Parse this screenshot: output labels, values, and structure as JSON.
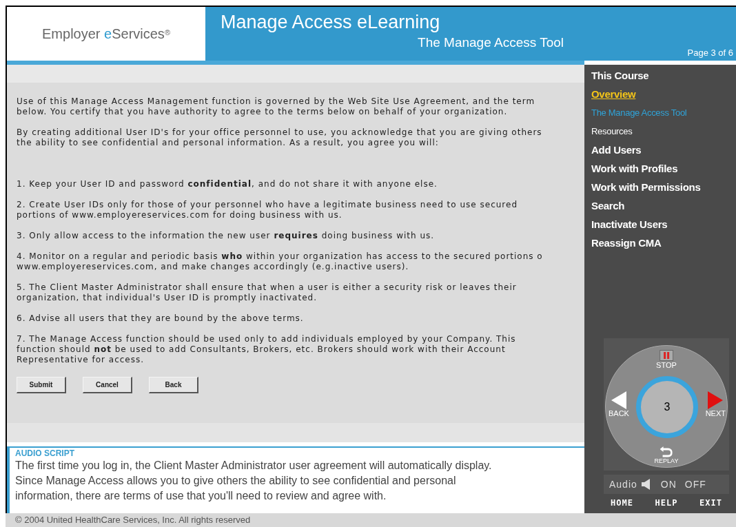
{
  "header": {
    "logo": {
      "prefix": "Employer ",
      "accent": "e",
      "suffix": "Services",
      "mark": "®"
    },
    "title": "Manage Access eLearning",
    "subtitle": "The Manage Access Tool",
    "page": "Page 3 of 6"
  },
  "agreement": {
    "paragraphs": [
      [
        "Use of this Manage Access Management function is governed by the Web Site Use Agreement, and the term",
        "below. You certify that you have authority to agree to the terms below on behalf of your organization."
      ],
      [
        "By creating additional User ID's for your office personnel to use, you acknowledge that you are giving others",
        "the ability to see confidential and personal information. As a result, you agree you will:"
      ]
    ],
    "terms": [
      [
        "1. Keep your User ID and password **confidential**, and do not share it with anyone else."
      ],
      [
        "2. Create User IDs only for those of your personnel who have a legitimate business need to use secured",
        "portions of www.employereservices.com for doing business with us."
      ],
      [
        "3. Only allow access to the information the new user **requires** doing business with us."
      ],
      [
        "4. Monitor on a regular and periodic basis **who** within your organization has access to the secured portions o",
        "www.employereservices.com, and make changes accordingly (e.g.inactive users)."
      ],
      [
        "5. The Client Master Administrator shall ensure that when a user is either a security risk or leaves their",
        "organization, that individual's User ID is promptly inactivated."
      ],
      [
        "6. Advise all users that they are bound by the above terms."
      ],
      [
        "7. The Manage Access function should be used only to add individuals employed by your Company. This",
        "function should **not** be used to add Consultants, Brokers, etc. Brokers should work with their Account",
        "Representative for access."
      ]
    ],
    "buttons": [
      "Submit",
      "Cancel",
      "Back"
    ]
  },
  "audio_script": {
    "heading": "AUDIO SCRIPT",
    "lines": [
      "The first time you log in, the Client Master Administrator user agreement will automatically display.",
      "Since Manage Access allows you to give others the ability to see confidential and personal",
      "information, there are terms of use that you'll need to review and agree with."
    ]
  },
  "footer": "© 2004 United HealthCare Services, Inc. All rights reserved",
  "course_nav": [
    {
      "label": "This Course",
      "kind": "heading"
    },
    {
      "label": "Overview",
      "kind": "current"
    },
    {
      "label": "The Manage Access Tool",
      "kind": "sub"
    },
    {
      "label": "Resources",
      "kind": "plain"
    },
    {
      "label": "Add Users",
      "kind": "section"
    },
    {
      "label": "Work with Profiles",
      "kind": "section"
    },
    {
      "label": "Work with Permissions",
      "kind": "section"
    },
    {
      "label": "Search",
      "kind": "section"
    },
    {
      "label": "Inactivate Users",
      "kind": "section"
    },
    {
      "label": "Reassign CMA",
      "kind": "section"
    }
  ],
  "player": {
    "stop": "STOP",
    "back": "BACK",
    "next": "NEXT",
    "replay": "REPLAY",
    "page": "3",
    "audio": "Audio",
    "on": "ON",
    "off": "OFF",
    "links": [
      "HOME",
      "HELP",
      "EXIT"
    ]
  }
}
